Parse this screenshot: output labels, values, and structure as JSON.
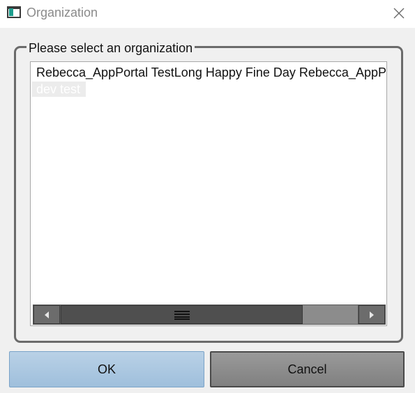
{
  "window": {
    "title": "Organization",
    "icon": "app-window-icon",
    "close_icon": "close-icon"
  },
  "group": {
    "label": "Please select an organization"
  },
  "list": {
    "items": [
      {
        "label": "Rebecca_AppPortal TestLong Happy Fine Day Rebecca_AppPortal TestLong Happy Fine Day",
        "selected": false
      },
      {
        "label": "dev test",
        "selected": true
      }
    ],
    "scrollbar": {
      "left_icon": "arrow-left-icon",
      "right_icon": "arrow-right-icon",
      "grip_icon": "grip-icon"
    }
  },
  "buttons": {
    "ok_label": "OK",
    "cancel_label": "Cancel"
  }
}
